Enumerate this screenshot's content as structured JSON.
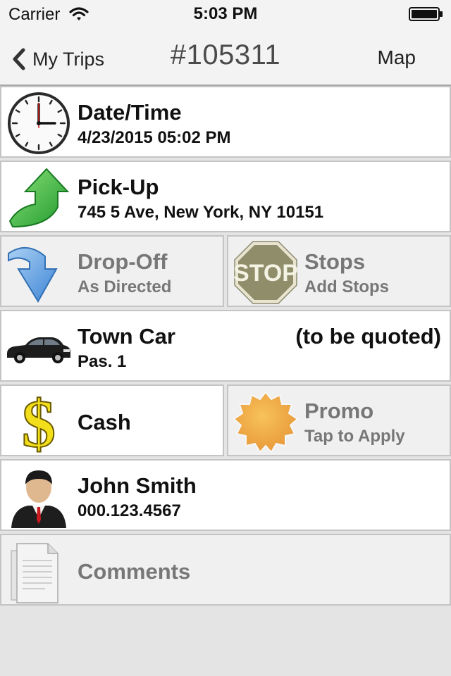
{
  "status": {
    "carrier": "Carrier",
    "time": "5:03 PM"
  },
  "nav": {
    "back_label": "My Trips",
    "title": "#105311",
    "right_label": "Map"
  },
  "rows": {
    "datetime": {
      "title": "Date/Time",
      "value": "4/23/2015 05:02 PM",
      "icon": "clock-icon"
    },
    "pickup": {
      "title": "Pick-Up",
      "value": "745 5 Ave, New York, NY 10151",
      "icon": "green-up-arrow-icon"
    },
    "dropoff": {
      "title": "Drop-Off",
      "value": "As Directed",
      "icon": "blue-down-arrow-icon"
    },
    "stops": {
      "title": "Stops",
      "value": "Add Stops",
      "icon": "stop-sign-icon",
      "sign_text": "STOP"
    },
    "vehicle": {
      "title": "Town Car",
      "quote": "(to be quoted)",
      "value": "Pas. 1",
      "icon": "town-car-icon"
    },
    "payment": {
      "title": "Cash",
      "icon": "dollar-sign-icon"
    },
    "promo": {
      "title": "Promo",
      "value": "Tap to Apply",
      "icon": "promo-badge-icon"
    },
    "passenger": {
      "title": "John Smith",
      "value": "000.123.4567",
      "icon": "person-avatar-icon"
    },
    "comments": {
      "title": "Comments",
      "icon": "document-icon"
    }
  },
  "colors": {
    "background": "#e4e4e4",
    "cell": "#ffffff",
    "disabled_cell": "#f0f0f0",
    "muted_text": "#777777"
  }
}
